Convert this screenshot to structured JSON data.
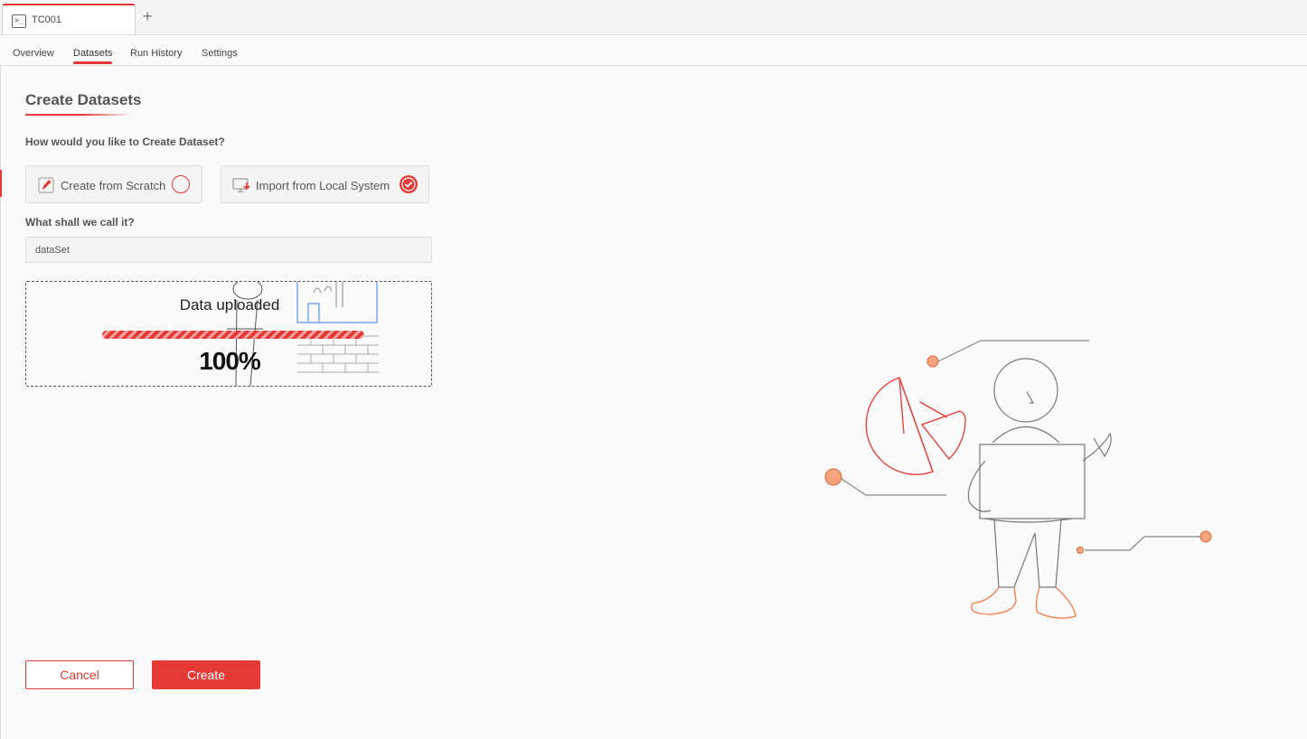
{
  "tab": {
    "title": "TC001",
    "terminal_glyph": ">_",
    "add_symbol": "+"
  },
  "nav": [
    {
      "label": "Overview",
      "active": false
    },
    {
      "label": "Datasets",
      "active": true
    },
    {
      "label": "Run History",
      "active": false
    },
    {
      "label": "Settings",
      "active": false
    }
  ],
  "form": {
    "title": "Create Datasets",
    "question_create": "How would you like to Create Dataset?",
    "option_scratch": {
      "label": "Create from Scratch",
      "selected": false
    },
    "option_import": {
      "label": "Import from Local System",
      "selected": true
    },
    "question_name": "What shall we call it?",
    "name_value": "dataSet"
  },
  "upload": {
    "message": "Data uploaded",
    "progress_text": "100%",
    "progress": 1.0
  },
  "actions": {
    "cancel_label": "Cancel",
    "create_label": "Create"
  },
  "colors": {
    "accent": "#e53935",
    "accent_light": "#f6a3a1",
    "orange": "#f27a4a",
    "line_gray": "#888888"
  }
}
